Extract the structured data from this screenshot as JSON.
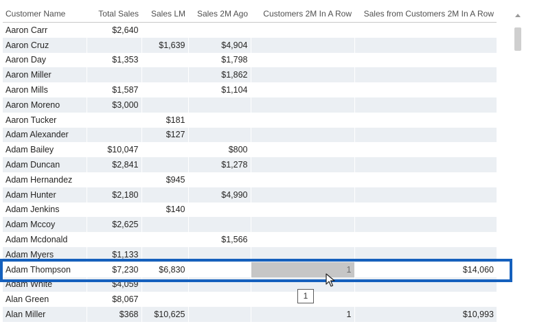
{
  "table": {
    "columns": [
      "Customer Name",
      "Total Sales",
      "Sales LM",
      "Sales 2M Ago",
      "Customers 2M In A Row",
      "Sales from Customers 2M In A Row"
    ],
    "rows": [
      [
        "Aaron Carr",
        "$2,640",
        "",
        "",
        "",
        ""
      ],
      [
        "Aaron Cruz",
        "",
        "$1,639",
        "$4,904",
        "",
        ""
      ],
      [
        "Aaron Day",
        "$1,353",
        "",
        "$1,798",
        "",
        ""
      ],
      [
        "Aaron Miller",
        "",
        "",
        "$1,862",
        "",
        ""
      ],
      [
        "Aaron Mills",
        "$1,587",
        "",
        "$1,104",
        "",
        ""
      ],
      [
        "Aaron Moreno",
        "$3,000",
        "",
        "",
        "",
        ""
      ],
      [
        "Aaron Tucker",
        "",
        "$181",
        "",
        "",
        ""
      ],
      [
        "Adam Alexander",
        "",
        "$127",
        "",
        "",
        ""
      ],
      [
        "Adam Bailey",
        "$10,047",
        "",
        "$800",
        "",
        ""
      ],
      [
        "Adam Duncan",
        "$2,841",
        "",
        "$1,278",
        "",
        ""
      ],
      [
        "Adam Hernandez",
        "",
        "$945",
        "",
        "",
        ""
      ],
      [
        "Adam Hunter",
        "$2,180",
        "",
        "$4,990",
        "",
        ""
      ],
      [
        "Adam Jenkins",
        "",
        "$140",
        "",
        "",
        ""
      ],
      [
        "Adam Mccoy",
        "$2,625",
        "",
        "",
        "",
        ""
      ],
      [
        "Adam Mcdonald",
        "",
        "",
        "$1,566",
        "",
        ""
      ],
      [
        "Adam Myers",
        "$1,133",
        "",
        "",
        "",
        ""
      ],
      [
        "Adam Thompson",
        "$7,230",
        "$6,830",
        "",
        "1",
        "$14,060"
      ],
      [
        "Adam White",
        "$4,059",
        "",
        "",
        "",
        ""
      ],
      [
        "Alan Green",
        "$8,067",
        "",
        "",
        "",
        ""
      ],
      [
        "Alan Miller",
        "$368",
        "$10,625",
        "",
        "1",
        "$10,993"
      ]
    ],
    "highlighted_row": 16,
    "selected_cell_column": 4
  },
  "tooltip": {
    "text": "1"
  },
  "colors": {
    "highlight_border": "#1560bd",
    "band": "#ebeff3",
    "selected_cell": "#c6c6c6"
  }
}
